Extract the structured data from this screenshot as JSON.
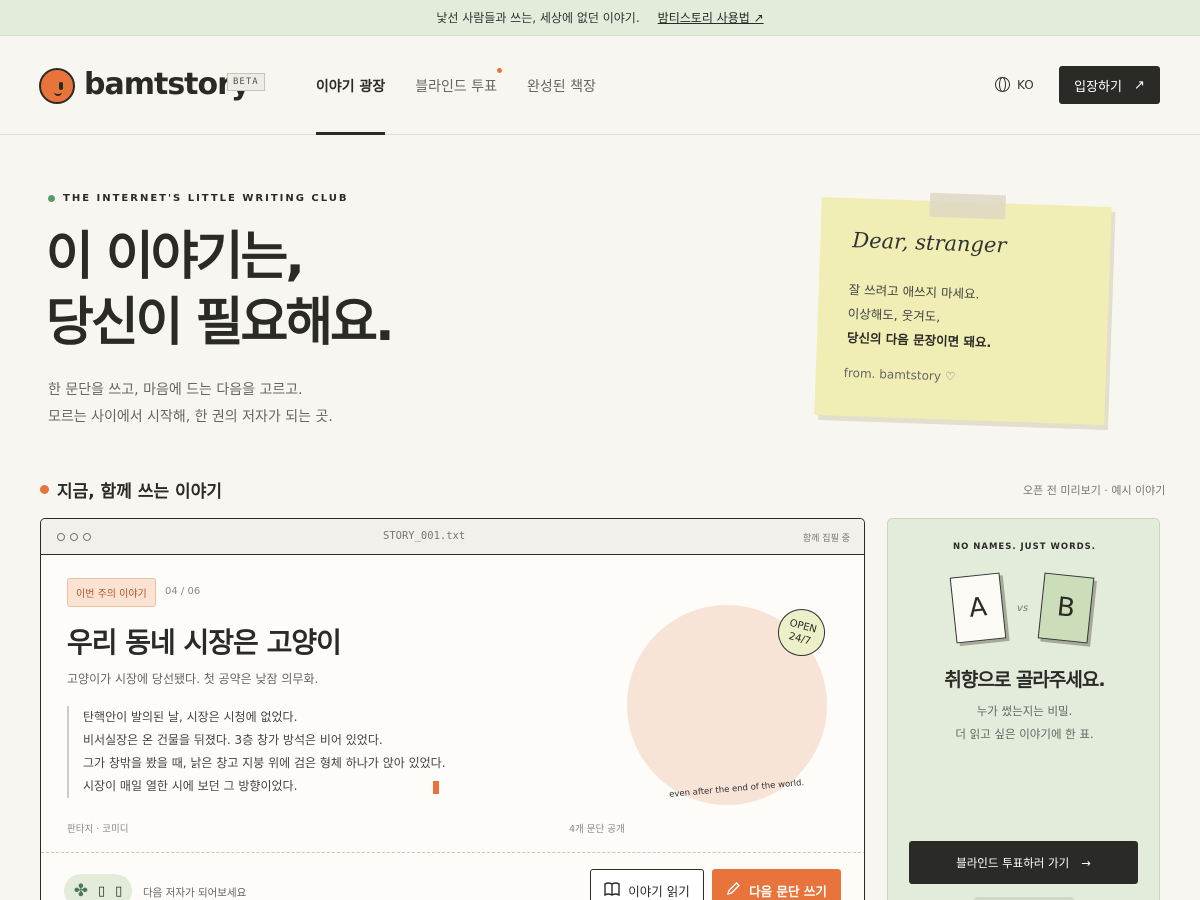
{
  "announcement": {
    "text": "낯선 사람들과 쓰는, 세상에 없던 이야기.",
    "link": "밤티스토리 사용법 ↗"
  },
  "brand": {
    "name": "bamtstory",
    "badge": "BETA",
    "accent": "#e8743b"
  },
  "nav": {
    "items": [
      {
        "label": "이야기 광장"
      },
      {
        "label": "블라인드 투표"
      },
      {
        "label": "완성된 책장"
      }
    ]
  },
  "lang": {
    "label": "KO"
  },
  "enter_button": {
    "label": "입장하기",
    "arrow": "↗"
  },
  "hero": {
    "eyebrow": "THE INTERNET'S LITTLE WRITING CLUB",
    "title_line1": "이 이야기는,",
    "title_line2": "당신이 필요해요.",
    "sub_line1": "한 문단을 쓰고, 마음에 드는 다음을 고르고.",
    "sub_line2": "모르는 사이에서 시작해, 한 권의 저자가 되는 곳."
  },
  "note": {
    "greeting": "Dear, stranger",
    "line1": "잘 쓰려고 애쓰지 마세요.",
    "line2": "이상해도, 웃겨도,",
    "line3": "당신의 다음 문장이면 돼요.",
    "signature": "from. bamtstory ♡"
  },
  "section": {
    "title": "지금, 함께 쓰는 이야기",
    "right_note": "오픈 전 미리보기 · 예시 이야기"
  },
  "story_card": {
    "filename": "STORY_001.txt",
    "status": "함께 집필 중",
    "badge": "이번 주의 이야기",
    "page": "04 / 06",
    "title": "우리 동네 시장은 고양이",
    "subtitle": "고양이가 시장에 당선됐다. 첫 공약은 낮잠 의무화.",
    "paragraph": [
      "탄핵안이 발의된 날, 시장은 시청에 없었다.",
      "비서실장은 온 건물을 뒤졌다. 3층 창가 방석은 비어 있었다.",
      "그가 창밖을 봤을 때, 낡은 창고 지붕 위에 검은 형체 하나가 앉아 있었다.",
      "시장이 매일 열한 시에 보던 그 방향이었다."
    ],
    "genre": "판타지 · 코미디",
    "open_count": "4개 문단 공개",
    "circle_caption": "even after the end of the world.",
    "stamp_line1": "OPEN",
    "stamp_line2": "24/7",
    "next_author": "다음 저자가 되어보세요",
    "read_button": "이야기 읽기",
    "write_button": "다음 문단 쓰기"
  },
  "vote_card": {
    "tag": "NO NAMES. JUST WORDS.",
    "a": "A",
    "vs": "vs",
    "b": "B",
    "heading": "취향으로 골라주세요.",
    "desc_line1": "누가 썼는지는 비밀.",
    "desc_line2": "더 읽고 싶은 이야기에 한 표.",
    "button": "블라인드 투표하러 가기",
    "arrow": "→"
  }
}
